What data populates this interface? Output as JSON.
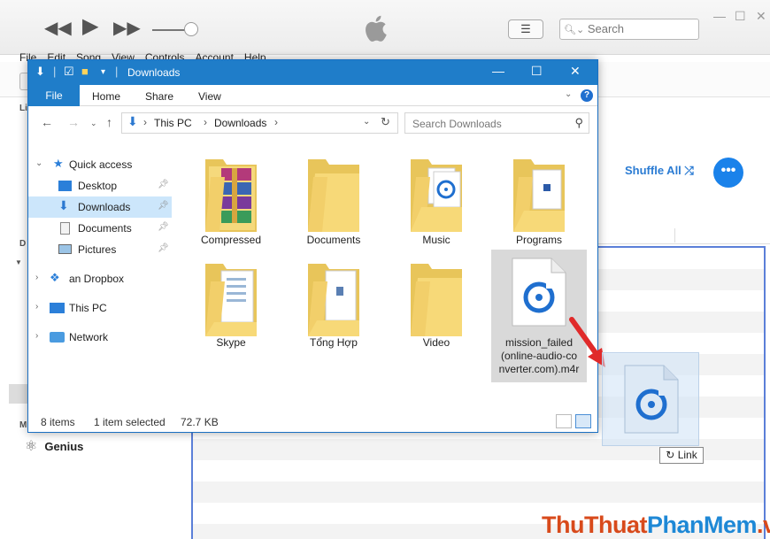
{
  "itunes": {
    "search_placeholder": "Search",
    "menu": [
      "File",
      "Edit",
      "Song",
      "View",
      "Controls",
      "Account",
      "Help"
    ],
    "side_letters": [
      "Li",
      "D",
      "M"
    ],
    "shuffle_label": "Shuffle All",
    "more_label": "•••",
    "genius_label": "Genius",
    "accent_color": "#1a82ea"
  },
  "explorer": {
    "title": "Downloads",
    "ribbon": {
      "file_tab": "File",
      "tabs": [
        "Home",
        "Share",
        "View"
      ]
    },
    "address": {
      "root": "This PC",
      "current": "Downloads"
    },
    "search_placeholder": "Search Downloads",
    "nav": {
      "quick_access": "Quick access",
      "items": [
        "Desktop",
        "Downloads",
        "Documents",
        "Pictures"
      ],
      "dropbox": "an Dropbox",
      "this_pc": "This PC",
      "network": "Network"
    },
    "files": [
      {
        "name": "Compressed",
        "kind": "folder-archive"
      },
      {
        "name": "Documents",
        "kind": "folder"
      },
      {
        "name": "Music",
        "kind": "folder-music"
      },
      {
        "name": "Programs",
        "kind": "folder-programs"
      },
      {
        "name": "Skype",
        "kind": "folder-doc"
      },
      {
        "name": "Tổng Hợp",
        "kind": "folder-doc"
      },
      {
        "name": "Video",
        "kind": "folder"
      },
      {
        "name_lines": [
          "mission_failed",
          "(online-audio-co",
          "nverter.com).m4r"
        ],
        "kind": "m4r-file",
        "selected": true
      }
    ],
    "status": {
      "count": "8 items",
      "selection": "1 item selected",
      "size": "72.7 KB"
    }
  },
  "drag": {
    "badge": "Link"
  },
  "watermark": {
    "part1": "ThuThuat",
    "part2": "PhanMem",
    "part3": ".vn"
  }
}
